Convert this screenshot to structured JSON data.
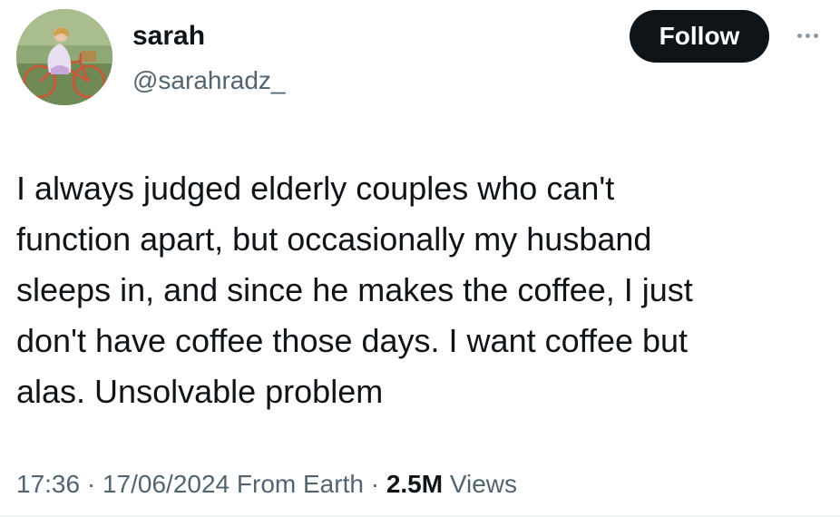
{
  "author": {
    "display_name": "sarah",
    "handle": "@sarahradz_",
    "avatar_icon": "profile-photo-girl-on-bicycle"
  },
  "actions": {
    "follow_label": "Follow",
    "more_icon": "more-horizontal-icon"
  },
  "tweet": {
    "lines": [
      "I always judged elderly couples who can't",
      "function apart, but occasionally my husband",
      "sleeps in, and since he makes the coffee, I just",
      "don't have coffee those days. I want coffee but",
      "alas. Unsolvable problem"
    ]
  },
  "meta": {
    "time": "17:36",
    "separator": "·",
    "date": "17/06/2024",
    "source": "From Earth",
    "views_count": "2.5M",
    "views_label": "Views"
  },
  "colors": {
    "text_primary": "#0f1419",
    "text_secondary": "#536471",
    "follow_bg": "#0f1419",
    "follow_text": "#ffffff"
  }
}
